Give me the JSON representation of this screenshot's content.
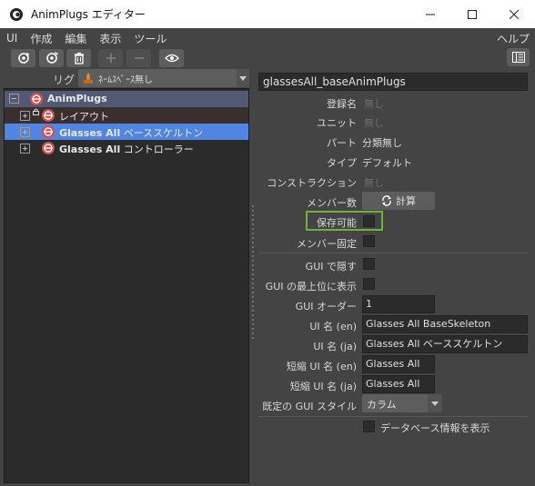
{
  "window": {
    "title": "AnimPlugs エディター",
    "buttons": [
      "minimize",
      "maximize",
      "close"
    ]
  },
  "menu": {
    "items": [
      "UI",
      "作成",
      "編集",
      "表示",
      "ツール"
    ],
    "help": "ヘルプ"
  },
  "toolbar": {
    "icons": [
      "add-gear-icon",
      "gear-refresh-icon",
      "trash-icon",
      "plus-icon",
      "minus-icon",
      "eye-icon",
      "panel-icon"
    ]
  },
  "rig": {
    "label": "リグ",
    "namespace": "ﾈｰﾑｽﾍﾟｰｽ無し"
  },
  "tree": {
    "root": "AnimPlugs",
    "items": [
      {
        "label": "レイアウト",
        "bold": ""
      },
      {
        "label": "ベーススケルトン",
        "bold": "Glasses All"
      },
      {
        "label": "コントローラー",
        "bold": "Glasses All"
      }
    ]
  },
  "properties": {
    "name": "glassesAll_baseAnimPlugs",
    "register_name": {
      "label": "登録名",
      "value": "無し"
    },
    "unit": {
      "label": "ユニット",
      "value": "無し"
    },
    "part": {
      "label": "パート",
      "value": "分類無し"
    },
    "type": {
      "label": "タイプ",
      "value": "デフォルト"
    },
    "construction": {
      "label": "コンストラクション",
      "value": "無し"
    },
    "member_count": {
      "label": "メンバー数",
      "button": "計算"
    },
    "savable": {
      "label": "保存可能",
      "checked": false
    },
    "member_lock": {
      "label": "メンバー固定",
      "checked": false
    },
    "gui_hide": {
      "label": "GUI で隠す",
      "checked": false
    },
    "gui_top": {
      "label": "GUI の最上位に表示",
      "checked": false
    },
    "gui_order": {
      "label": "GUI オーダー",
      "value": "1"
    },
    "ui_name_en": {
      "label": "UI 名 (en)",
      "value": "Glasses All BaseSkeleton"
    },
    "ui_name_ja": {
      "label": "UI 名 (ja)",
      "value": "Glasses All ベーススケルトン"
    },
    "short_name_en": {
      "label": "短縮 UI 名 (en)",
      "value": "Glasses All"
    },
    "short_name_ja": {
      "label": "短縮 UI 名 (ja)",
      "value": "Glasses All"
    },
    "gui_style": {
      "label": "既定の GUI スタイル",
      "value": "カラム"
    },
    "show_db": {
      "label": "データベース情報を表示",
      "checked": false
    }
  },
  "colors": {
    "accent_selection": "#5285e0",
    "root_row": "#525a73",
    "highlight": "#6fb13c",
    "plug_icon": "#d94a4a"
  }
}
